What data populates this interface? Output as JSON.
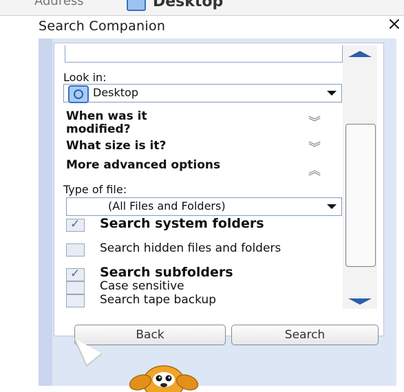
{
  "address_bar": {
    "label": "Address",
    "value": "Desktop"
  },
  "pane": {
    "title": "Search Companion",
    "close": "×"
  },
  "look_in": {
    "label": "Look in:",
    "value": "Desktop"
  },
  "sections": {
    "modified": "When was it modified?",
    "size": "What size is it?",
    "advanced": "More advanced options"
  },
  "type_of_file": {
    "label": "Type of file:",
    "value": "(All Files and Folders)"
  },
  "options": [
    {
      "label": "Search system folders",
      "checked": true
    },
    {
      "label": "Search hidden files and folders",
      "checked": false
    },
    {
      "label": "Search subfolders",
      "checked": true
    },
    {
      "label": "Case sensitive",
      "checked": false
    },
    {
      "label": "Search tape backup",
      "checked": false
    }
  ],
  "buttons": {
    "back": "Back",
    "search": "Search"
  },
  "icons": {
    "desktop": "desktop-icon",
    "expand": "double-chevron-down-icon",
    "collapse": "double-chevron-up-icon",
    "assistant": "dog-assistant-icon"
  }
}
